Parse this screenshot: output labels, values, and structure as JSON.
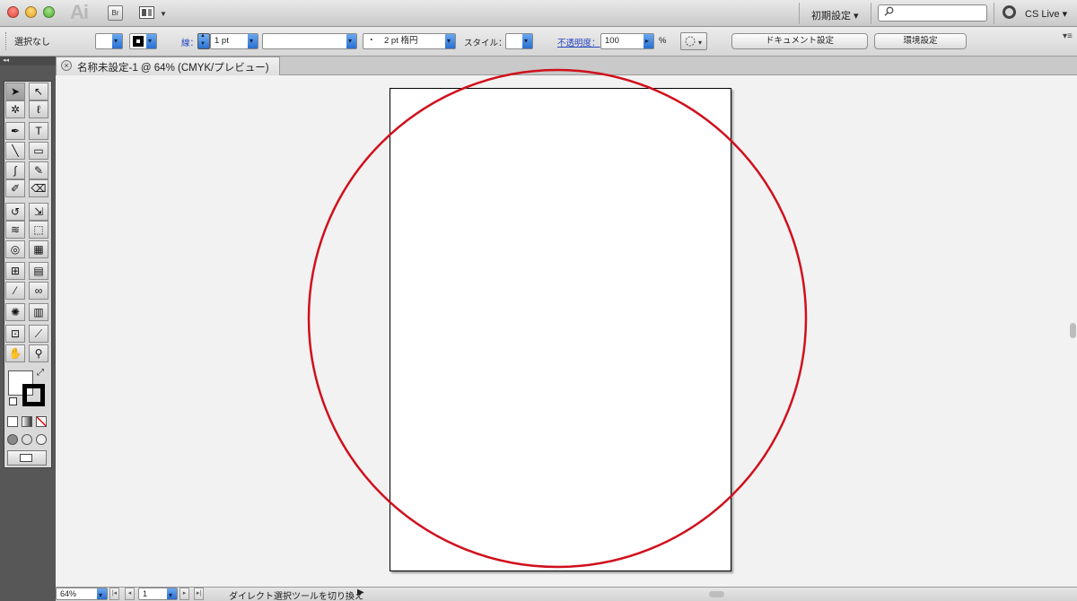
{
  "app": {
    "logo": "Ai",
    "bridge": "Br",
    "workspace": "初期設定 ▾",
    "cslive": "CS Live ▾"
  },
  "control": {
    "selection": "選択なし",
    "stroke_label": "線：",
    "stroke_weight": "1 pt",
    "brush": "・　2 pt 楕円",
    "style_label": "スタイル：",
    "opacity_label": "不透明度：",
    "opacity": "100",
    "opacity_unit": "%",
    "doc_setup": "ドキュメント設定",
    "prefs": "環境設定"
  },
  "tab": {
    "close": "×",
    "title": "名称未設定-1 @ 64% (CMYK/プレビュー)"
  },
  "status": {
    "zoom": "64%",
    "page": "1",
    "message": "ダイレクト選択ツールを切り換え",
    "arrow": "▶"
  },
  "colors": {
    "highlight_circle": "#d0101c",
    "artboard": "#ffffff",
    "canvas": "#f2f2f2"
  },
  "tools": [
    {
      "name": "selection-tool",
      "glyph": "➤"
    },
    {
      "name": "direct-selection-tool",
      "glyph": "↖"
    },
    {
      "name": "magic-wand-tool",
      "glyph": "✲"
    },
    {
      "name": "lasso-tool",
      "glyph": "ℓ"
    },
    {
      "name": "pen-tool",
      "glyph": "✒"
    },
    {
      "name": "type-tool",
      "glyph": "T"
    },
    {
      "name": "line-tool",
      "glyph": "╲"
    },
    {
      "name": "rectangle-tool",
      "glyph": "▭"
    },
    {
      "name": "paintbrush-tool",
      "glyph": "∫"
    },
    {
      "name": "pencil-tool",
      "glyph": "✎"
    },
    {
      "name": "blob-brush-tool",
      "glyph": "✐"
    },
    {
      "name": "eraser-tool",
      "glyph": "⌫"
    },
    {
      "name": "rotate-tool",
      "glyph": "↺"
    },
    {
      "name": "scale-tool",
      "glyph": "⇲"
    },
    {
      "name": "warp-tool",
      "glyph": "≋"
    },
    {
      "name": "free-transform-tool",
      "glyph": "⬚"
    },
    {
      "name": "shape-builder-tool",
      "glyph": "◎"
    },
    {
      "name": "perspective-grid-tool",
      "glyph": "▦"
    },
    {
      "name": "mesh-tool",
      "glyph": "⊞"
    },
    {
      "name": "gradient-tool",
      "glyph": "▤"
    },
    {
      "name": "eyedropper-tool",
      "glyph": "⁄"
    },
    {
      "name": "blend-tool",
      "glyph": "∞"
    },
    {
      "name": "symbol-sprayer-tool",
      "glyph": "✺"
    },
    {
      "name": "column-graph-tool",
      "glyph": "▥"
    },
    {
      "name": "artboard-tool",
      "glyph": "⊡"
    },
    {
      "name": "slice-tool",
      "glyph": "⟋"
    },
    {
      "name": "hand-tool",
      "glyph": "✋"
    },
    {
      "name": "zoom-tool",
      "glyph": "⚲"
    }
  ]
}
